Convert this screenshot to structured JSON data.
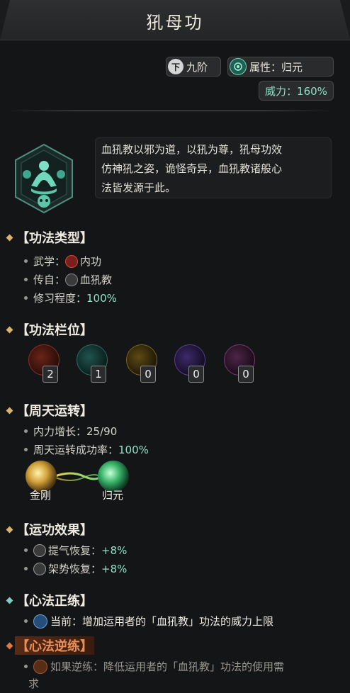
{
  "header": {
    "title": "犼母功"
  },
  "badges": {
    "grade_icon": "下",
    "grade": "九阶",
    "attribute": "属性：归元",
    "power": "威力：160%"
  },
  "description": {
    "lines": [
      "血犼教以邪为道，以犼为尊，犼母功效",
      "仿神犼之姿，诡怪奇异，血犼教诸般心",
      "法皆发源于此。"
    ]
  },
  "sections": {
    "type": {
      "heading": "【功法类型】",
      "martial_label": "武学：",
      "martial_value": "内功",
      "source_label": "传自：",
      "source_value": "血犼教",
      "progress_label": "修习程度：",
      "progress_value": "100%"
    },
    "slots": {
      "heading": "【功法栏位】",
      "items": [
        {
          "count": "2",
          "color": "#b8402e"
        },
        {
          "count": "1",
          "color": "#3b8f86"
        },
        {
          "count": "0",
          "color": "#b8962e"
        },
        {
          "count": "0",
          "color": "#7d52c4"
        },
        {
          "count": "0",
          "color": "#9a4a8c"
        }
      ]
    },
    "cycle": {
      "heading": "【周天运转】",
      "growth_label": "内力增长：",
      "growth_value": "25/90",
      "success_label": "周天运转成功率：",
      "success_value": "100%",
      "from": "金刚",
      "to": "归元"
    },
    "effects": {
      "heading": "【运功效果】",
      "items": [
        {
          "label": "提气恢复：",
          "value": "+8%"
        },
        {
          "label": "架势恢复：",
          "value": "+8%"
        }
      ]
    },
    "positive": {
      "heading": "【心法正练】",
      "prefix": "当前：",
      "text": "增加运用者的「血犼教」功法的威力上限"
    },
    "reverse": {
      "heading": "【心法逆练】",
      "prefix": "如果逆练：",
      "text_line1": "降低运用者的「血犼教」功法的使用需",
      "text_line2": "求"
    }
  },
  "colors": {
    "accent_teal": "#8fe0c8",
    "diamond_gold": "#d9b46a",
    "diamond_teal": "#7ccfc2",
    "diamond_orange": "#e07a3a",
    "reverse_header_bg": "#5a2a14"
  }
}
